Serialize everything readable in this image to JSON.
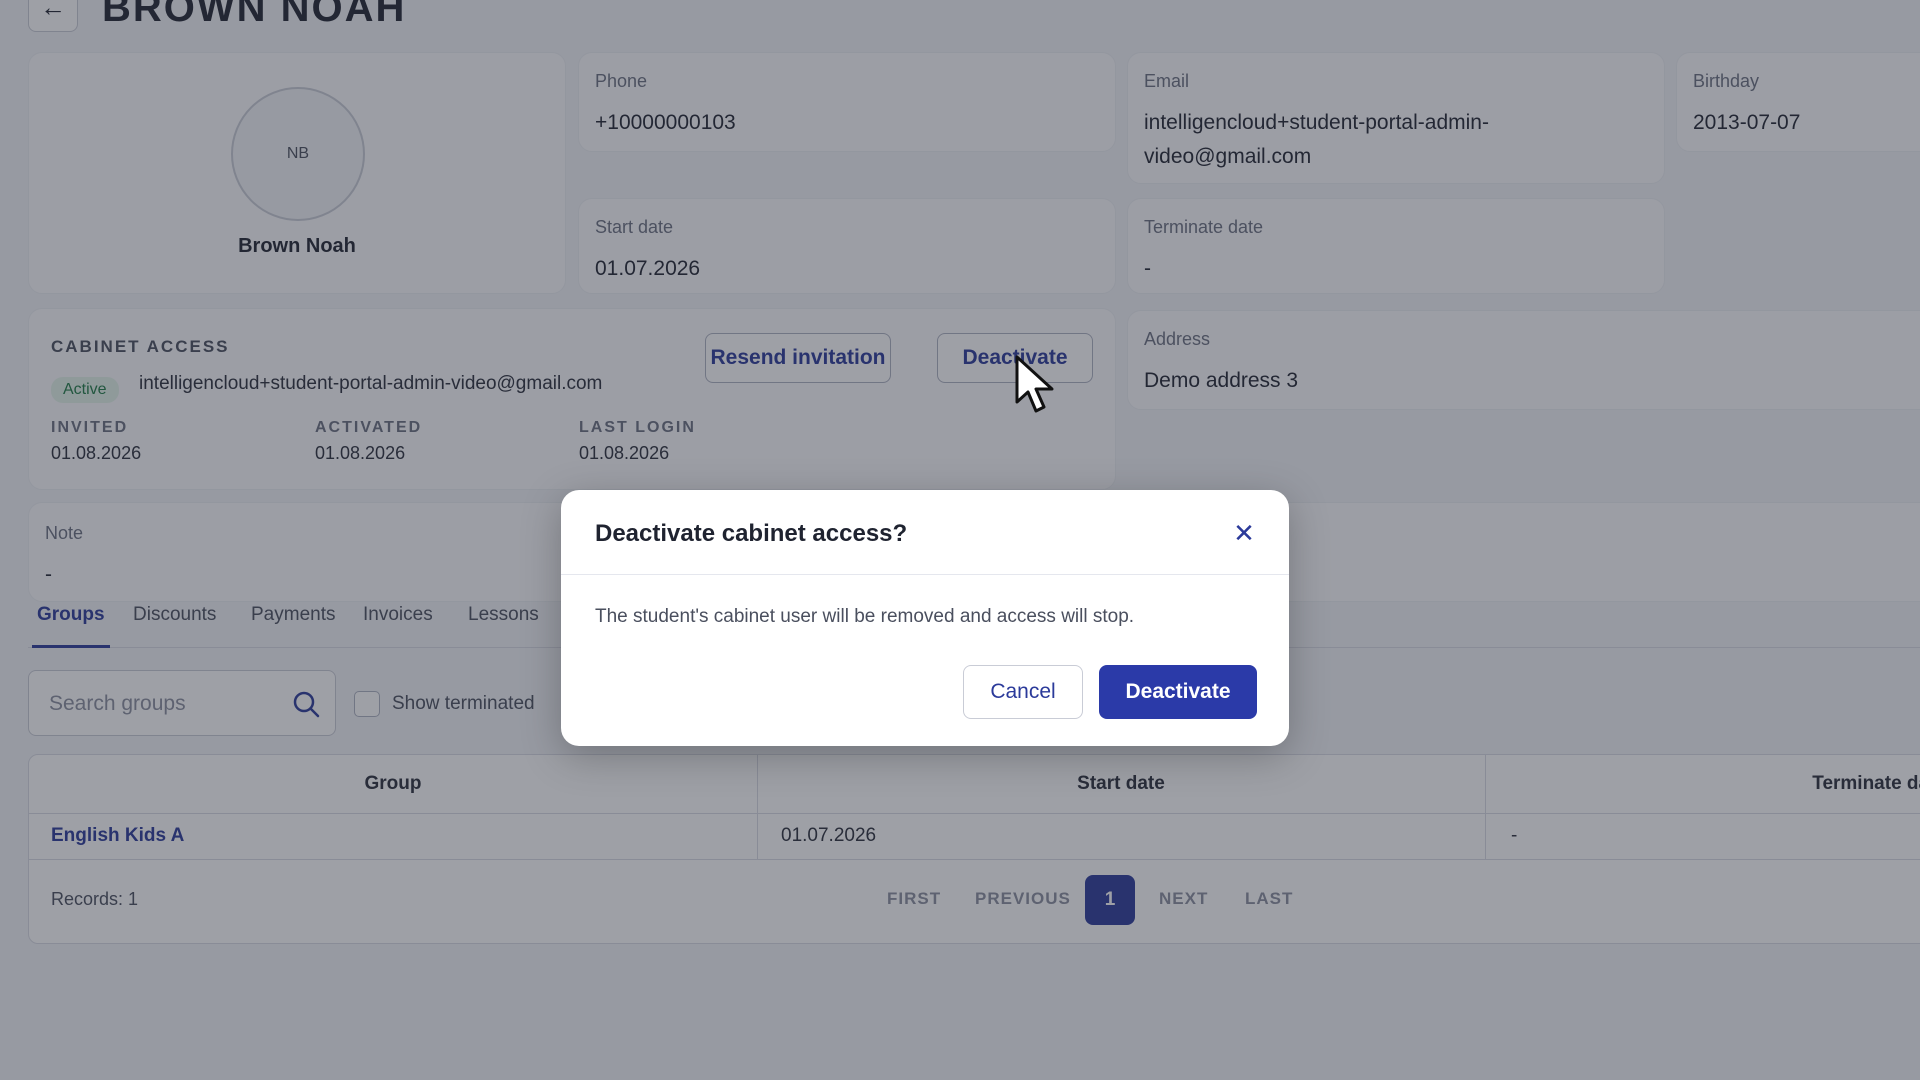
{
  "header": {
    "back_glyph": "←",
    "title": "BROWN NOAH"
  },
  "profile": {
    "initials": "NB",
    "name": "Brown Noah"
  },
  "fields": {
    "phone": {
      "label": "Phone",
      "value": "+10000000103"
    },
    "email": {
      "label": "Email",
      "value_line1": "intelligencloud+student-portal-admin-",
      "value_line2": "video@gmail.com"
    },
    "birthday": {
      "label": "Birthday",
      "value": "2013-07-07"
    },
    "start_date": {
      "label": "Start date",
      "value": "01.07.2026"
    },
    "terminate_date": {
      "label": "Terminate date",
      "value": "-"
    },
    "address": {
      "label": "Address",
      "value": "Demo address 3"
    },
    "note": {
      "label": "Note",
      "value": "-"
    }
  },
  "cabinet": {
    "title": "CABINET ACCESS",
    "status": "Active",
    "email": "intelligencloud+student-portal-admin-video@gmail.com",
    "resend_label": "Resend invitation",
    "deactivate_label": "Deactivate",
    "invited_label": "INVITED",
    "invited_value": "01.08.2026",
    "activated_label": "ACTIVATED",
    "activated_value": "01.08.2026",
    "last_login_label": "LAST LOGIN",
    "last_login_value": "01.08.2026"
  },
  "tabs": [
    {
      "label": "Groups",
      "active": true
    },
    {
      "label": "Discounts"
    },
    {
      "label": "Payments"
    },
    {
      "label": "Invoices"
    },
    {
      "label": "Lessons"
    }
  ],
  "search": {
    "placeholder": "Search groups",
    "show_terminated_label": "Show terminated"
  },
  "table": {
    "headers": [
      "Group",
      "Start date",
      "Terminate date"
    ],
    "rows": [
      {
        "group": "English Kids A",
        "start": "01.07.2026",
        "terminate": "-"
      }
    ],
    "records": "Records: 1",
    "pager": {
      "first": "FIRST",
      "previous": "PREVIOUS",
      "current": "1",
      "next": "NEXT",
      "last": "LAST"
    }
  },
  "modal": {
    "title": "Deactivate cabinet access?",
    "close_glyph": "✕",
    "body": "The student's cabinet user will be removed and access will stop.",
    "cancel_label": "Cancel",
    "confirm_label": "Deactivate"
  },
  "colors": {
    "accent": "#2b3aa8",
    "active_badge_bg": "#e3f4ea",
    "active_badge_text": "#1e7a44"
  }
}
